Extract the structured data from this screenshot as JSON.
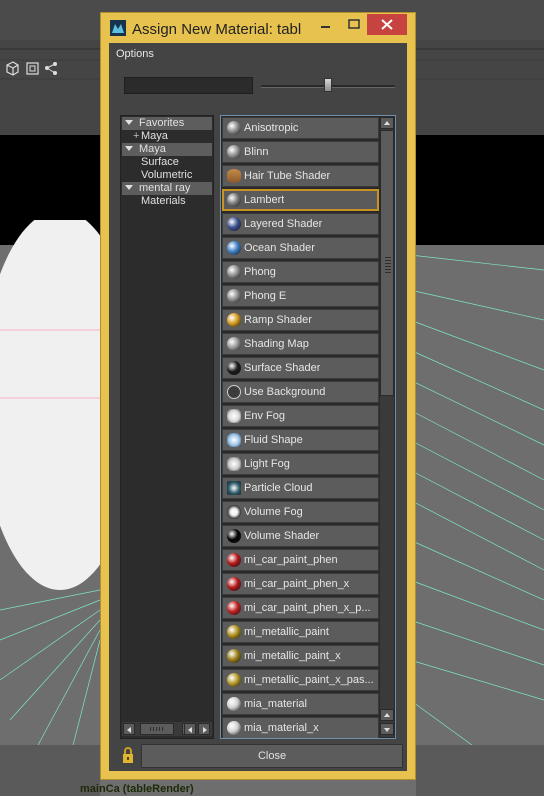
{
  "window": {
    "title": "Assign New Material: tabl",
    "menu": [
      "Options"
    ]
  },
  "filter": {
    "value": ""
  },
  "icon_size_slider": {
    "value": 0.5
  },
  "tree": [
    {
      "label": "Favorites",
      "type": "header"
    },
    {
      "label": "Maya",
      "type": "child",
      "prefix": "+"
    },
    {
      "label": "Maya",
      "type": "header"
    },
    {
      "label": "Surface",
      "type": "child"
    },
    {
      "label": "Volumetric",
      "type": "child"
    },
    {
      "label": "mental ray",
      "type": "header"
    },
    {
      "label": "Materials",
      "type": "child"
    }
  ],
  "materials": [
    {
      "label": "Anisotropic",
      "icon": "sphere-grey-icon",
      "color": "#8a8a8a"
    },
    {
      "label": "Blinn",
      "icon": "sphere-grey-icon",
      "color": "#909090"
    },
    {
      "label": "Hair Tube Shader",
      "icon": "hair-tube-icon",
      "color": "#8a5a2a"
    },
    {
      "label": "Lambert",
      "icon": "sphere-grey-icon",
      "color": "#7a7a7a",
      "selected": true
    },
    {
      "label": "Layered Shader",
      "icon": "sphere-layered-icon",
      "color": "#3c4f90"
    },
    {
      "label": "Ocean Shader",
      "icon": "ocean-icon",
      "color": "#3f7fc4"
    },
    {
      "label": "Phong",
      "icon": "sphere-grey-icon",
      "color": "#8e8e8e"
    },
    {
      "label": "Phong E",
      "icon": "sphere-grey-icon",
      "color": "#8e8e8e"
    },
    {
      "label": "Ramp Shader",
      "icon": "ramp-icon",
      "color": "#d49a1e"
    },
    {
      "label": "Shading Map",
      "icon": "sphere-flat-icon",
      "color": "#9a9a9a"
    },
    {
      "label": "Surface Shader",
      "icon": "sphere-dark-icon",
      "color": "#1a1a1a"
    },
    {
      "label": "Use Background",
      "icon": "circle-outline-icon",
      "color": "#3c3c3c"
    },
    {
      "label": "Env Fog",
      "icon": "env-fog-icon",
      "color": "#d8d8d8"
    },
    {
      "label": "Fluid Shape",
      "icon": "fluid-icon",
      "color": "#9cc4e8"
    },
    {
      "label": "Light Fog",
      "icon": "light-fog-icon",
      "color": "#c8c8c8"
    },
    {
      "label": "Particle Cloud",
      "icon": "particle-cloud-icon",
      "color": "#2b5a6a"
    },
    {
      "label": "Volume Fog",
      "icon": "volume-fog-icon",
      "color": "#f0f0f0"
    },
    {
      "label": "Volume Shader",
      "icon": "sphere-black-icon",
      "color": "#050505"
    },
    {
      "label": "mi_car_paint_phen",
      "icon": "sphere-red-icon",
      "color": "#b41818"
    },
    {
      "label": "mi_car_paint_phen_x",
      "icon": "sphere-red-icon",
      "color": "#b41818"
    },
    {
      "label": "mi_car_paint_phen_x_p...",
      "icon": "sphere-red-icon",
      "color": "#c02020"
    },
    {
      "label": "mi_metallic_paint",
      "icon": "sphere-gold-icon",
      "color": "#b0901c"
    },
    {
      "label": "mi_metallic_paint_x",
      "icon": "sphere-gold-icon",
      "color": "#9c7f1a"
    },
    {
      "label": "mi_metallic_paint_x_pas...",
      "icon": "sphere-gold-icon",
      "color": "#b49a2a"
    },
    {
      "label": "mia_material",
      "icon": "sphere-white-icon",
      "color": "#d0d0d0"
    },
    {
      "label": "mia_material_x",
      "icon": "sphere-white-icon",
      "color": "#d0d0d0"
    }
  ],
  "footer": {
    "close_label": "Close"
  },
  "viewport": {
    "camera_caption": "mainCa (tableRender)"
  },
  "colors": {
    "frame": "#e7c24f",
    "close_button": "#c7433f",
    "selection": "#c79323",
    "panel": "#444444",
    "list_border": "#6f8faa"
  }
}
